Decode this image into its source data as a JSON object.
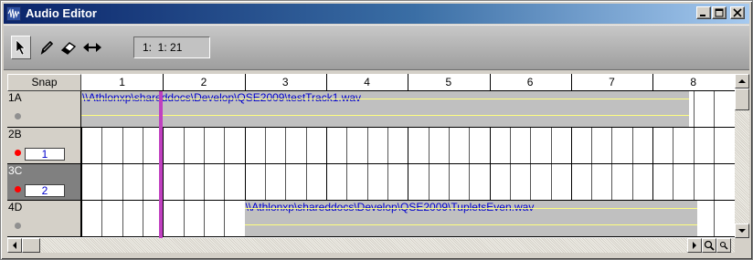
{
  "window": {
    "title": "Audio Editor",
    "colors": {
      "title_start": "#0a246a",
      "title_end": "#a6caf0",
      "playhead": "#c040c0",
      "clip_text": "#0000cc",
      "record_dot": "#ff0000"
    }
  },
  "toolbar": {
    "tools": [
      {
        "name": "select",
        "icon": "arrow-cursor-icon",
        "selected": true
      },
      {
        "name": "pencil",
        "icon": "pencil-icon",
        "selected": false
      },
      {
        "name": "eraser",
        "icon": "eraser-icon",
        "selected": false
      },
      {
        "name": "move",
        "icon": "double-arrow-icon",
        "selected": false
      }
    ],
    "position": "1:  1: 21"
  },
  "snap_label": "Snap",
  "ruler": {
    "measures": [
      "1",
      "2",
      "3",
      "4",
      "5",
      "6",
      "7",
      "8"
    ]
  },
  "tracks": [
    {
      "name": "1A",
      "armed": false,
      "channel": "",
      "selected": false,
      "clip": {
        "label": "\\\\Athlonxp\\shareddocs\\Develop\\QSE2009\\testTrack1.wav",
        "start_measure": 1,
        "end_measure": 8.45
      }
    },
    {
      "name": "2B",
      "armed": true,
      "channel": "1",
      "selected": false,
      "clip": null
    },
    {
      "name": "3C",
      "armed": true,
      "channel": "2",
      "selected": true,
      "clip": null
    },
    {
      "name": "4D",
      "armed": false,
      "channel": "",
      "selected": false,
      "clip": {
        "label": "\\\\Athlonxp\\shareddocs\\Develop\\QSE2009\\TupletsEven.wav",
        "start_measure": 3.0,
        "end_measure": 8.55
      }
    }
  ],
  "playhead_measure": 1.95
}
